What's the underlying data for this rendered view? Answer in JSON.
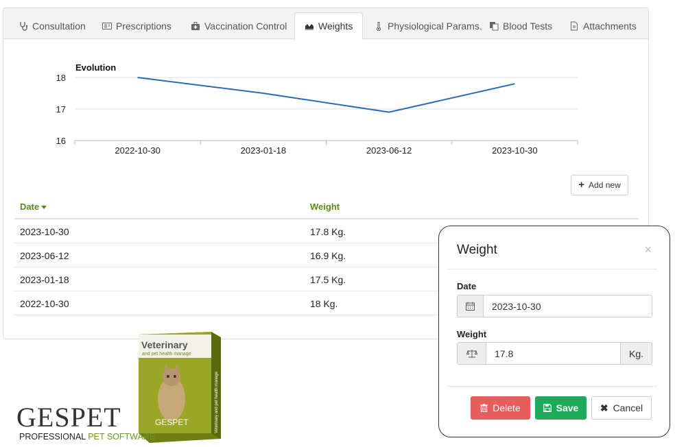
{
  "tabs": [
    {
      "label": "Consultation",
      "icon": "stethoscope-icon"
    },
    {
      "label": "Prescriptions",
      "icon": "prescription-icon"
    },
    {
      "label": "Vaccination Control",
      "icon": "medkit-icon"
    },
    {
      "label": "Weights",
      "icon": "area-chart-icon",
      "active": true
    },
    {
      "label": "Physiological Params.",
      "icon": "thermometer-icon"
    },
    {
      "label": "Blood Tests",
      "icon": "copy-icon"
    },
    {
      "label": "Attachments",
      "icon": "file-icon"
    }
  ],
  "chart_data": {
    "type": "line",
    "title": "Evolution",
    "categories": [
      "2022-10-30",
      "2023-01-18",
      "2023-06-12",
      "2023-10-30"
    ],
    "series": [
      {
        "values": [
          18,
          17.5,
          16.9,
          17.8
        ],
        "color": "#2a6ab5"
      }
    ],
    "yticks": [
      16,
      17,
      18
    ],
    "ylim": [
      16,
      18
    ],
    "grid": true
  },
  "add_new_label": "Add new",
  "table": {
    "columns": [
      "Date",
      "Weight"
    ],
    "sort_column": "Date",
    "rows": [
      [
        "2023-10-30",
        "17.8 Kg."
      ],
      [
        "2023-06-12",
        "16.9 Kg."
      ],
      [
        "2023-01-18",
        "17.5 Kg."
      ],
      [
        "2022-10-30",
        "18 Kg."
      ]
    ]
  },
  "modal": {
    "title": "Weight",
    "close_symbol": "×",
    "date_label": "Date",
    "date_value": "2023-10-30",
    "weight_label": "Weight",
    "weight_value": "17.8",
    "weight_unit": "Kg.",
    "delete_label": "Delete",
    "save_label": "Save",
    "cancel_label": "Cancel"
  },
  "branding": {
    "logo": "GESPET",
    "tagline_prefix": "PROFESSIONAL ",
    "tagline_green": "PET SOFTWARE",
    "box_title": "Veterinary",
    "box_subtitle": "and pet health manage",
    "box_side": "Veterinary and pet health manage",
    "box_logo": "GESPET",
    "accent_green": "#5a8a1e",
    "box_color": "#8a9a1c"
  }
}
